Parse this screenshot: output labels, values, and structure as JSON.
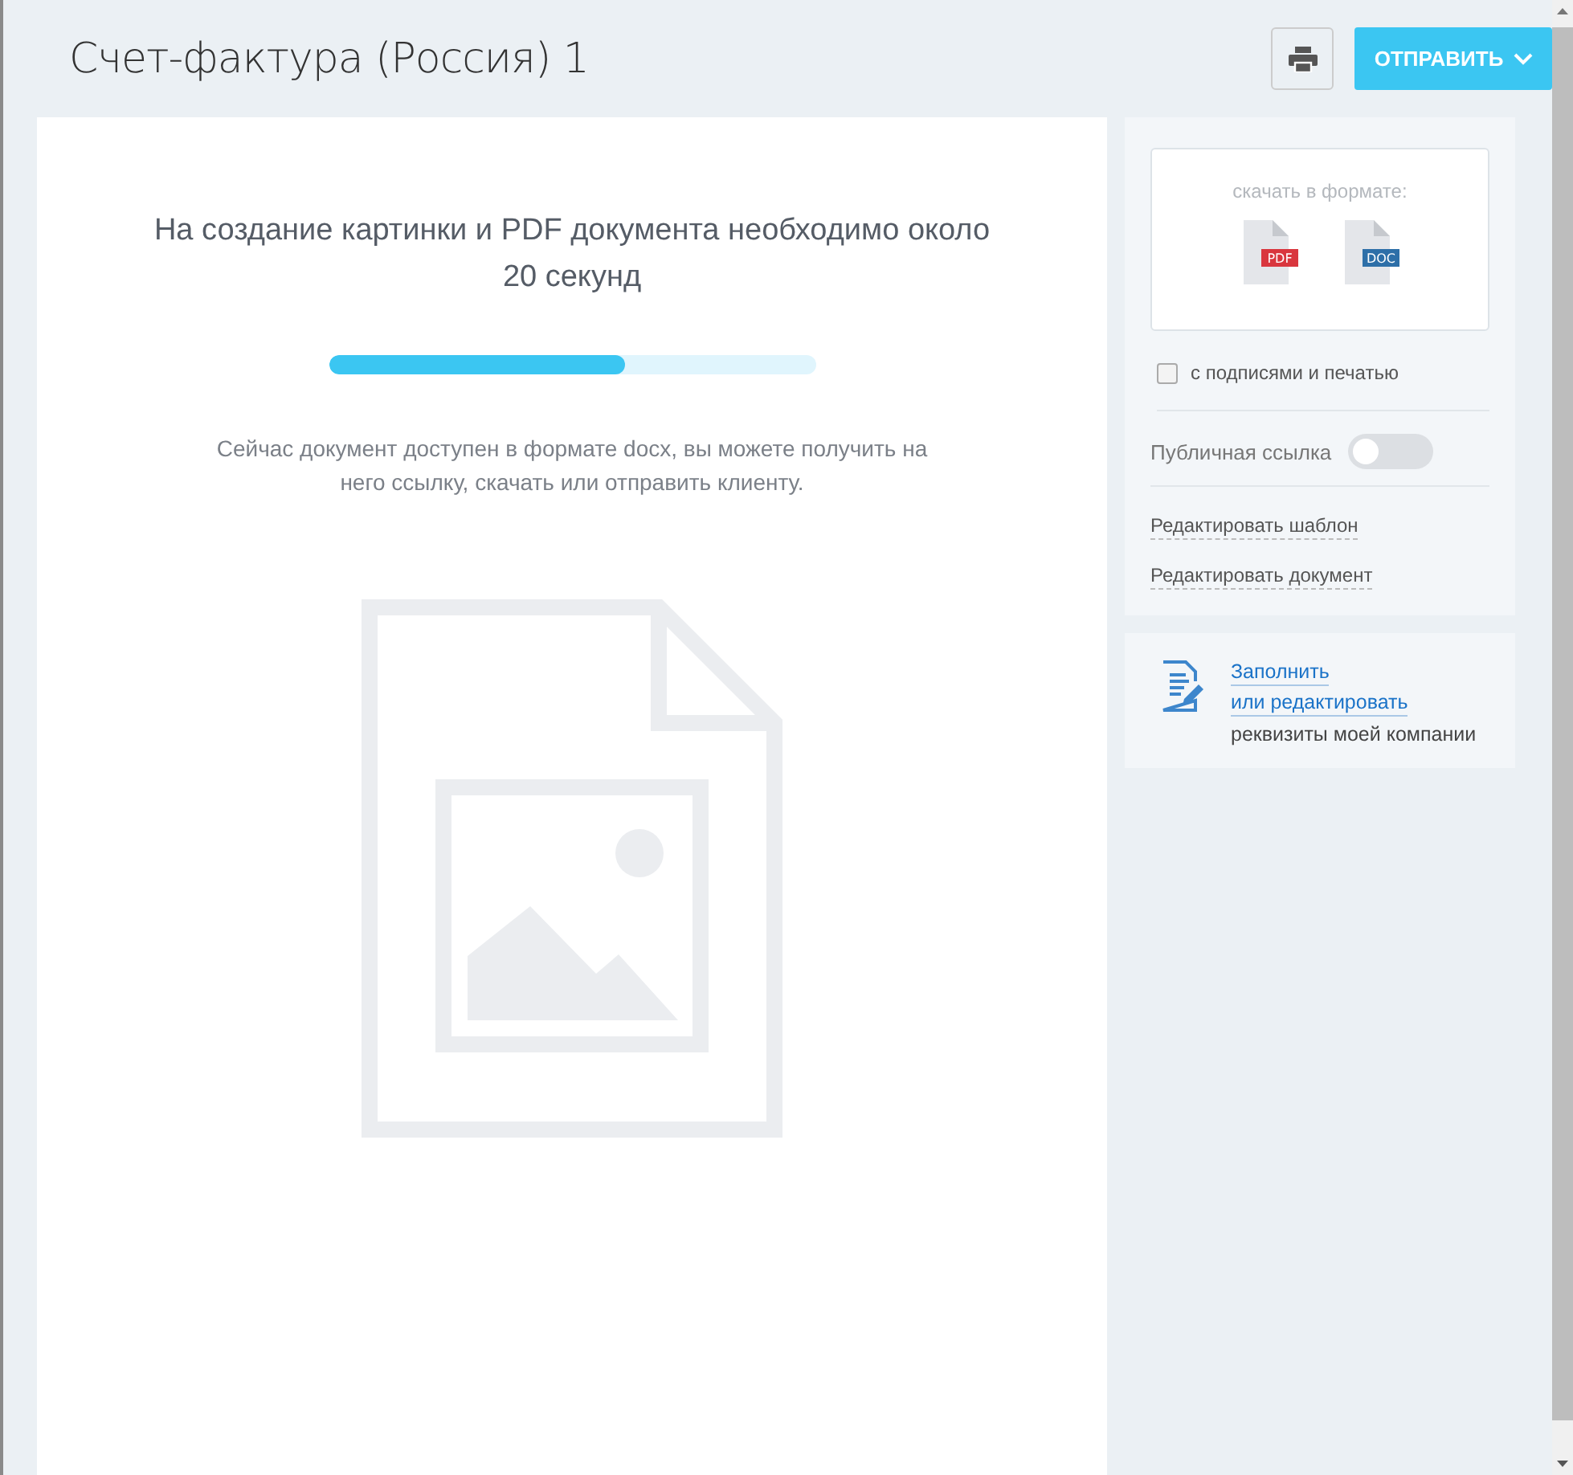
{
  "header": {
    "title": "Счет-фактура (Россия) 1",
    "send_button": "ОТПРАВИТЬ"
  },
  "preview": {
    "message": "На создание картинки и PDF документа необходимо около 20 секунд",
    "progress": {
      "level": 0.61
    },
    "note": "Сейчас документ доступен в формате docx, вы можете получить на него ссылку, скачать или отправить клиенту."
  },
  "download": {
    "label": "скачать в формате:",
    "formats": [
      {
        "label": "PDF",
        "kind": "pdf"
      },
      {
        "label": "DOC",
        "kind": "doc"
      }
    ]
  },
  "signatures": {
    "label": "с подписями и печатью",
    "checked": false
  },
  "public_link": {
    "label": "Публичная ссылка",
    "on": false
  },
  "links": [
    "Редактировать шаблон",
    "Редактировать документ"
  ],
  "company": {
    "link_1": "Заполнить",
    "link_2": "или редактировать",
    "text": "реквизиты моей компании"
  }
}
